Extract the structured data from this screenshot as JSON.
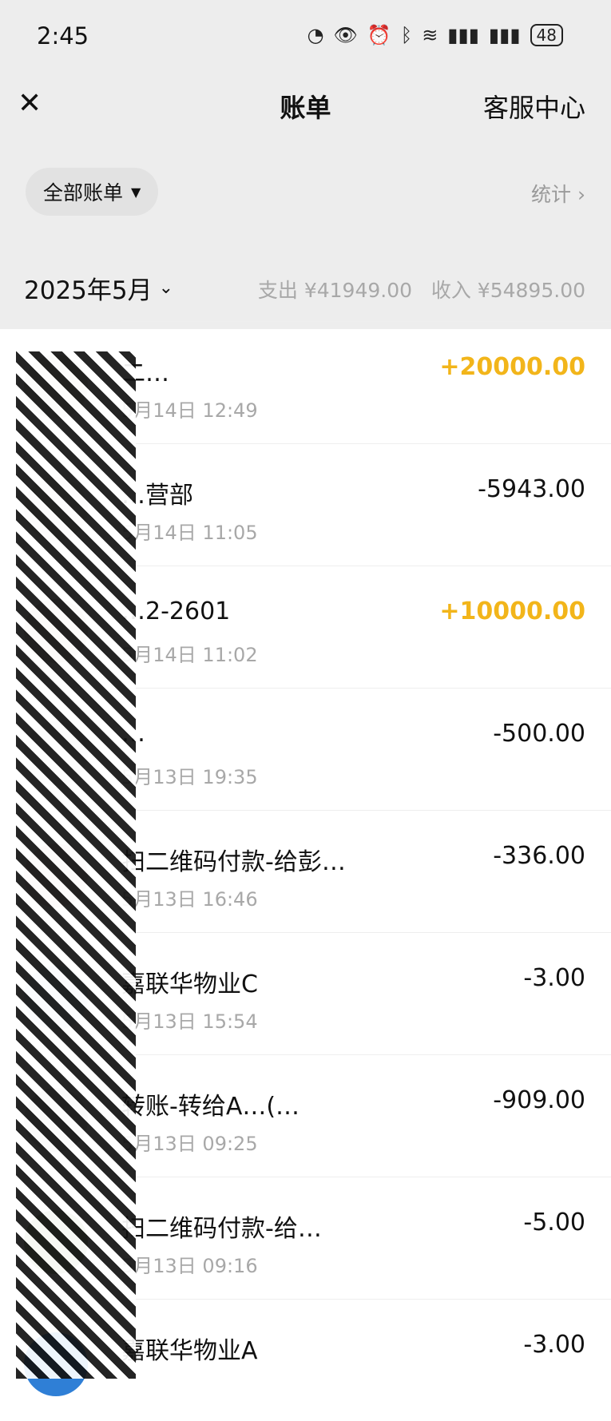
{
  "status_bar": {
    "time": "2:45",
    "signal_label": "6",
    "battery": "48"
  },
  "header": {
    "close_icon": "close-icon",
    "title": "账单",
    "service_label": "客服中心"
  },
  "filter": {
    "label": "全部账单",
    "stats_label": "统计"
  },
  "month_bar": {
    "month": "2025年5月",
    "expense": "支出 ¥41949.00",
    "income": "收入 ¥54895.00"
  },
  "transactions": [
    {
      "name": "二…",
      "date": "5月14日 12:49",
      "amount": "+20000.00",
      "type": "income"
    },
    {
      "name": "…营部",
      "date": "5月14日 11:05",
      "amount": "-5943.00",
      "type": "expense"
    },
    {
      "name": "…2-2601",
      "date": "5月14日 11:02",
      "amount": "+10000.00",
      "type": "income"
    },
    {
      "name": "…",
      "date": "5月13日 19:35",
      "amount": "-500.00",
      "type": "expense"
    },
    {
      "name": "扫二维码付款-给彭…",
      "date": "5月13日 16:46",
      "amount": "-336.00",
      "type": "expense"
    },
    {
      "name": "嘉联华物业C",
      "date": "5月13日 15:54",
      "amount": "-3.00",
      "type": "expense"
    },
    {
      "name": "转账-转给A…(…",
      "date": "5月13日 09:25",
      "amount": "-909.00",
      "type": "expense"
    },
    {
      "name": "扫二维码付款-给…",
      "date": "5月13日 09:16",
      "amount": "-5.00",
      "type": "expense"
    },
    {
      "name": "嘉联华物业A",
      "date": "",
      "amount": "-3.00",
      "type": "expense"
    }
  ],
  "colors": {
    "income": "#f2b51a",
    "expense": "#111111",
    "header_bg": "#ededed"
  }
}
